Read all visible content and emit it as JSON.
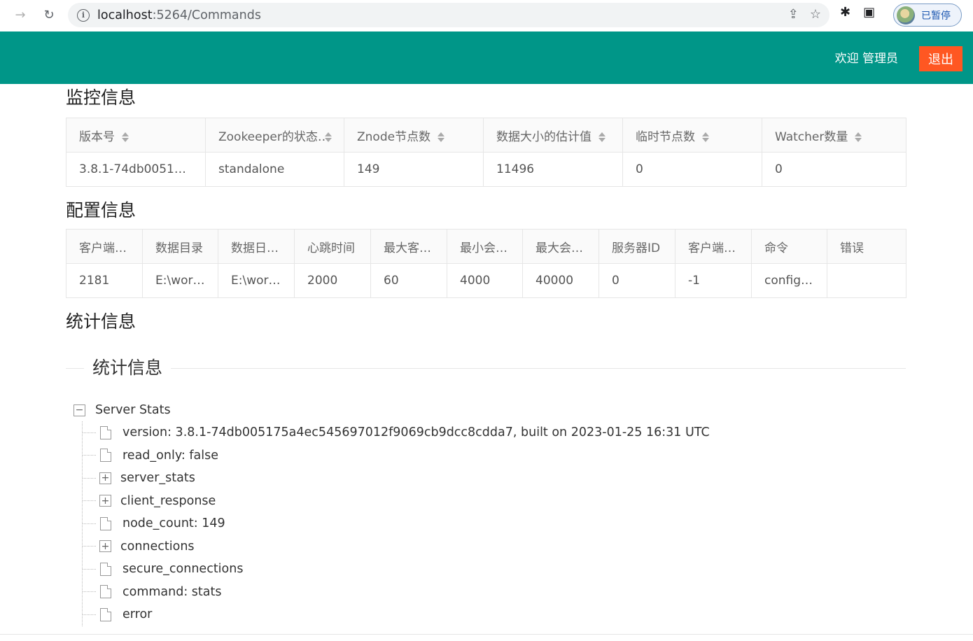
{
  "browser": {
    "url_host": "localhost",
    "url_path": ":5264/Commands",
    "profile_label": "已暂停"
  },
  "header": {
    "welcome": "欢迎 管理员",
    "logout_label": "退出"
  },
  "monitor": {
    "title": "监控信息",
    "columns": [
      "版本号",
      "Zookeeper的状态",
      "Znode节点数",
      "数据大小的估计值",
      "临时节点数",
      "Watcher数量"
    ],
    "row": [
      "3.8.1-74db005175…",
      "standalone",
      "149",
      "11496",
      "0",
      "0"
    ]
  },
  "config": {
    "title": "配置信息",
    "columns": [
      "客户端…",
      "数据目录",
      "数据日…",
      "心跳时间",
      "最大客…",
      "最小会…",
      "最大会…",
      "服务器ID",
      "客户端…",
      "命令",
      "错误"
    ],
    "row": [
      "2181",
      "E:\\wor…",
      "E:\\wor…",
      "2000",
      "60",
      "4000",
      "40000",
      "0",
      "-1",
      "config…",
      ""
    ]
  },
  "stats": {
    "title": "统计信息",
    "legend": "统计信息",
    "tree": {
      "root_label": "Server Stats",
      "root_toggle": "−",
      "children": [
        {
          "label": "version: 3.8.1-74db005175a4ec545697012f9069cb9dcc8cdda7, built on 2023-01-25 16:31 UTC",
          "kind": "file"
        },
        {
          "label": "read_only: false",
          "kind": "file"
        },
        {
          "label": "server_stats",
          "kind": "folder",
          "toggle": "+"
        },
        {
          "label": "client_response",
          "kind": "folder",
          "toggle": "+"
        },
        {
          "label": "node_count: 149",
          "kind": "file"
        },
        {
          "label": "connections",
          "kind": "folder",
          "toggle": "+"
        },
        {
          "label": "secure_connections",
          "kind": "file"
        },
        {
          "label": "command: stats",
          "kind": "file"
        },
        {
          "label": "error",
          "kind": "file"
        }
      ]
    }
  },
  "colors": {
    "header_bg": "#009688",
    "logout_bg": "#ff5722"
  }
}
